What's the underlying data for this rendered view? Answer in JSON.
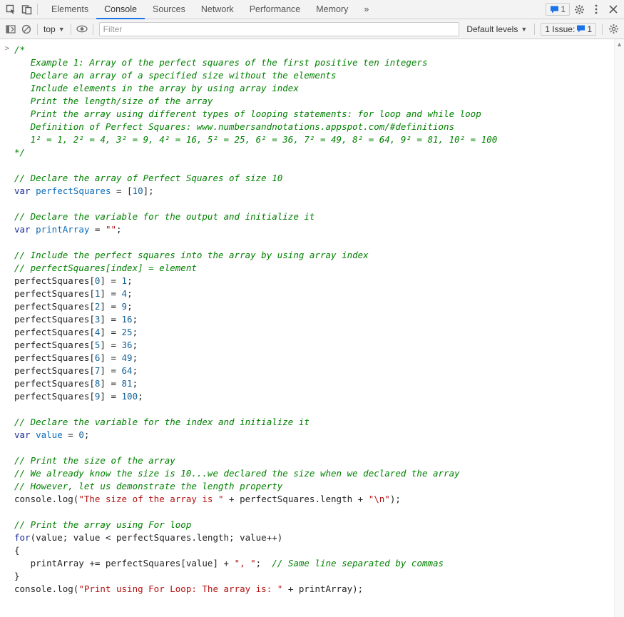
{
  "tabs": {
    "elements": "Elements",
    "console": "Console",
    "sources": "Sources",
    "network": "Network",
    "performance": "Performance",
    "memory": "Memory"
  },
  "topbar": {
    "messageCount": "1"
  },
  "subbar": {
    "context": "top",
    "filterPlaceholder": "Filter",
    "levels": "Default levels",
    "issueLabel": "1 Issue:",
    "issueCount": "1"
  },
  "code": {
    "gutter": ">",
    "c01": "/*",
    "c02": "   Example 1: Array of the perfect squares of the first positive ten integers",
    "c03": "   Declare an array of a specified size without the elements",
    "c04": "   Include elements in the array by using array index",
    "c05": "   Print the length/size of the array",
    "c06": "   Print the array using different types of looping statements: for loop and while loop",
    "c07": "   Definition of Perfect Squares: www.numbersandnotations.appspot.com/#definitions",
    "c08": "   1² = 1, 2² = 4, 3² = 9, 4² = 16, 5² = 25, 6² = 36, 7² = 49, 8² = 64, 9² = 81, 10² = 100",
    "c09": "*/",
    "c10": "// Declare the array of Perfect Squares of size 10",
    "varKw": "var",
    "ps": "perfectSquares",
    "eq": " = ",
    "arr10": "[10];",
    "n10": "10",
    "c11": "// Declare the variable for the output and initialize it",
    "pa": "printArray",
    "emptyStr": "\"\"",
    "semi": ";",
    "c12": "// Include the perfect squares into the array by using array index",
    "c13": "// perfectSquares[index] = element",
    "idx0": "0",
    "idx1": "1",
    "idx2": "2",
    "idx3": "3",
    "idx4": "4",
    "idx5": "5",
    "idx6": "6",
    "idx7": "7",
    "idx8": "8",
    "idx9": "9",
    "v1": "1",
    "v4": "4",
    "v9": "9",
    "v16": "16",
    "v25": "25",
    "v36": "36",
    "v49": "49",
    "v64": "64",
    "v81": "81",
    "v100": "100",
    "c14": "// Declare the variable for the index and initialize it",
    "valVar": "value",
    "zero": "0",
    "c15": "// Print the size of the array",
    "c16": "// We already know the size is 10...we declared the size when we declared the array",
    "c17": "// However, let us demonstrate the length property",
    "consoleLog": "console.log(",
    "str1": "\"The size of the array is \"",
    "plus": " + ",
    "psLen": "perfectSquares.length",
    "strNl": "\"\\n\"",
    "closeParen": ");",
    "c18": "// Print the array using For loop",
    "forKw": "for",
    "forCond1": "(value; value < perfectSquares.length; value++)",
    "openBrace": "{",
    "closeBrace": "}",
    "indent": "   ",
    "paPlusEq": "printArray += perfectSquares[value] + ",
    "commaSpStr": "\", \"",
    "c19": "// Same line separated by commas",
    "str2": "\"Print using For Loop: The array is: \"",
    "paRef": "printArray"
  }
}
